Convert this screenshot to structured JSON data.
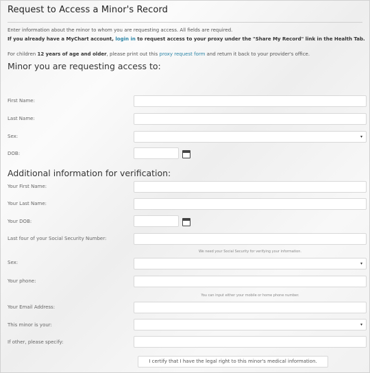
{
  "page": {
    "title": "Request to Access a Minor's Record",
    "intro_line1": "Enter information about the minor to whom you are requesting access. All fields are required.",
    "intro_line2_pre": "If you already have a MyChart account, ",
    "intro_line2_link": "login in",
    "intro_line2_post": " to request access to your proxy under the \"Share My Record\" link in the Health Tab.",
    "intro_line3_pre": "For children ",
    "intro_line3_bold": "12 years of age and older",
    "intro_line3_mid": ", please print out this ",
    "intro_line3_link": "proxy request form",
    "intro_line3_post": " and return it back to your provider's office."
  },
  "minor": {
    "heading": "Minor you are requesting access to:",
    "first_name_label": "First Name:",
    "last_name_label": "Last Name:",
    "sex_label": "Sex:",
    "dob_label": "DOB:"
  },
  "verify": {
    "heading": "Additional information for verification:",
    "your_first_name_label": "Your First Name:",
    "your_last_name_label": "Your Last Name:",
    "your_dob_label": "Your DOB:",
    "ssn_label": "Last four of your Social Security Number:",
    "ssn_help": "We need your Social Security for verifying your information.",
    "sex_label": "Sex:",
    "phone_label": "Your phone:",
    "phone_help": "You can input either your mobile or home phone number.",
    "email_label": "Your Email Address:",
    "relation_label": "This minor is your:",
    "other_label": "If other, please specify:"
  },
  "certify_label": "I certify that I have the legal right to this minor's medical information.",
  "icons": {
    "dropdown": "▾",
    "calendar": "calendar-icon"
  }
}
